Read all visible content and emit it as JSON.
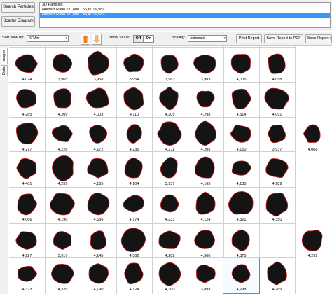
{
  "sidebar": {
    "buttons": [
      {
        "label": "Search Particles"
      },
      {
        "label": "Scatter Diagram"
      }
    ]
  },
  "filter_list": {
    "items": [
      {
        "label": "3D Particles",
        "selected": false
      },
      {
        "label": "(Aspect Ratio < 0,800 ) 55,60 %(Vol)",
        "selected": false
      },
      {
        "label": "(Aspect Ratio > 0,800 ) 44,40 %(Vol)",
        "selected": true
      }
    ]
  },
  "toolbar": {
    "sort_label": "Sort view by:",
    "sort_value": "XFMin",
    "show_value_label": "Show Value:",
    "toggle_off": "Off",
    "toggle_on": "On",
    "toggle_state": "On",
    "scaling_label": "Scaling:",
    "scaling_value": "Automatic",
    "print_report": "Print Report",
    "save_pdf": "Save Report to PDF",
    "save_report_as": "Save Report as"
  },
  "side_tabs": [
    {
      "label": "Images"
    },
    {
      "label": "Data"
    }
  ],
  "colors": {
    "outline": "#cc2222",
    "particle": "#141414",
    "selection": "#3399ff"
  },
  "particles": [
    {
      "value": "4,024"
    },
    {
      "value": "3,965"
    },
    {
      "value": "3,958"
    },
    {
      "value": "3,954"
    },
    {
      "value": "3,963"
    },
    {
      "value": "3,983"
    },
    {
      "value": "4,005"
    },
    {
      "value": "4,058"
    },
    {
      "value": "4,265"
    },
    {
      "value": "4,209"
    },
    {
      "value": "4,003"
    },
    {
      "value": "4,110"
    },
    {
      "value": "4,205"
    },
    {
      "value": "4,298"
    },
    {
      "value": "4,514"
    },
    {
      "value": "4,091"
    },
    {
      "value": "4,217"
    },
    {
      "value": "4,226"
    },
    {
      "value": "4,172"
    },
    {
      "value": "4,236"
    },
    {
      "value": "4,211"
    },
    {
      "value": "4,205"
    },
    {
      "value": "4,150"
    },
    {
      "value": "3,937"
    },
    {
      "value": "4,068"
    },
    {
      "value": "4,401"
    },
    {
      "value": "4,259"
    },
    {
      "value": "4,165"
    },
    {
      "value": "4,104"
    },
    {
      "value": "3,937"
    },
    {
      "value": "4,165"
    },
    {
      "value": "4,130"
    },
    {
      "value": "4,189"
    },
    {
      "value": "4,066"
    },
    {
      "value": "4,190"
    },
    {
      "value": "4,636"
    },
    {
      "value": "4,174"
    },
    {
      "value": "4,233"
    },
    {
      "value": "4,124"
    },
    {
      "value": "4,321"
    },
    {
      "value": "4,350"
    },
    {
      "value": "4,227"
    },
    {
      "value": "3,917"
    },
    {
      "value": "4,145"
    },
    {
      "value": "4,302"
    },
    {
      "value": "4,202"
    },
    {
      "value": "4,360"
    },
    {
      "value": "4,375"
    },
    {
      "value": "",
      "empty": true
    },
    {
      "value": "4,292"
    },
    {
      "value": "4,323"
    },
    {
      "value": "4,320"
    },
    {
      "value": "4,190"
    },
    {
      "value": "4,124"
    },
    {
      "value": "4,300"
    },
    {
      "value": "3,898"
    },
    {
      "value": "4,298",
      "selected": true
    },
    {
      "value": "4,269"
    }
  ]
}
